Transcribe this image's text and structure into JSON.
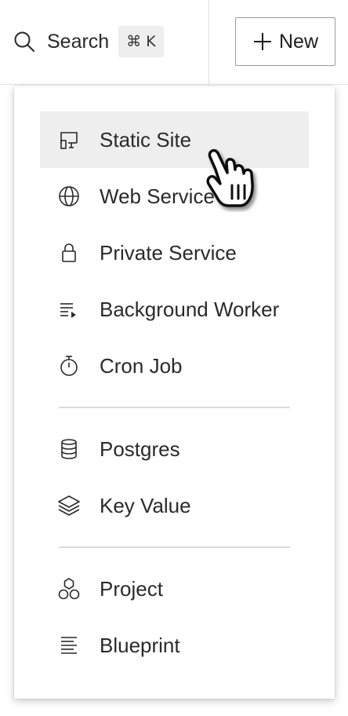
{
  "topbar": {
    "search": {
      "icon": "search-icon",
      "label": "Search",
      "shortcut_symbol": "⌘",
      "shortcut_key": "K"
    },
    "new_button": {
      "icon": "plus-icon",
      "label": "New"
    }
  },
  "menu": {
    "groups": [
      [
        {
          "icon": "static-site-icon",
          "label": "Static Site",
          "hovered": true
        },
        {
          "icon": "globe-icon",
          "label": "Web Service"
        },
        {
          "icon": "lock-icon",
          "label": "Private Service"
        },
        {
          "icon": "background-worker-icon",
          "label": "Background Worker"
        },
        {
          "icon": "stopwatch-icon",
          "label": "Cron Job"
        }
      ],
      [
        {
          "icon": "database-icon",
          "label": "Postgres"
        },
        {
          "icon": "layers-icon",
          "label": "Key Value"
        }
      ],
      [
        {
          "icon": "project-icon",
          "label": "Project"
        },
        {
          "icon": "blueprint-icon",
          "label": "Blueprint"
        }
      ]
    ]
  },
  "cursor": {
    "icon": "hand-pointer-cursor-icon"
  }
}
